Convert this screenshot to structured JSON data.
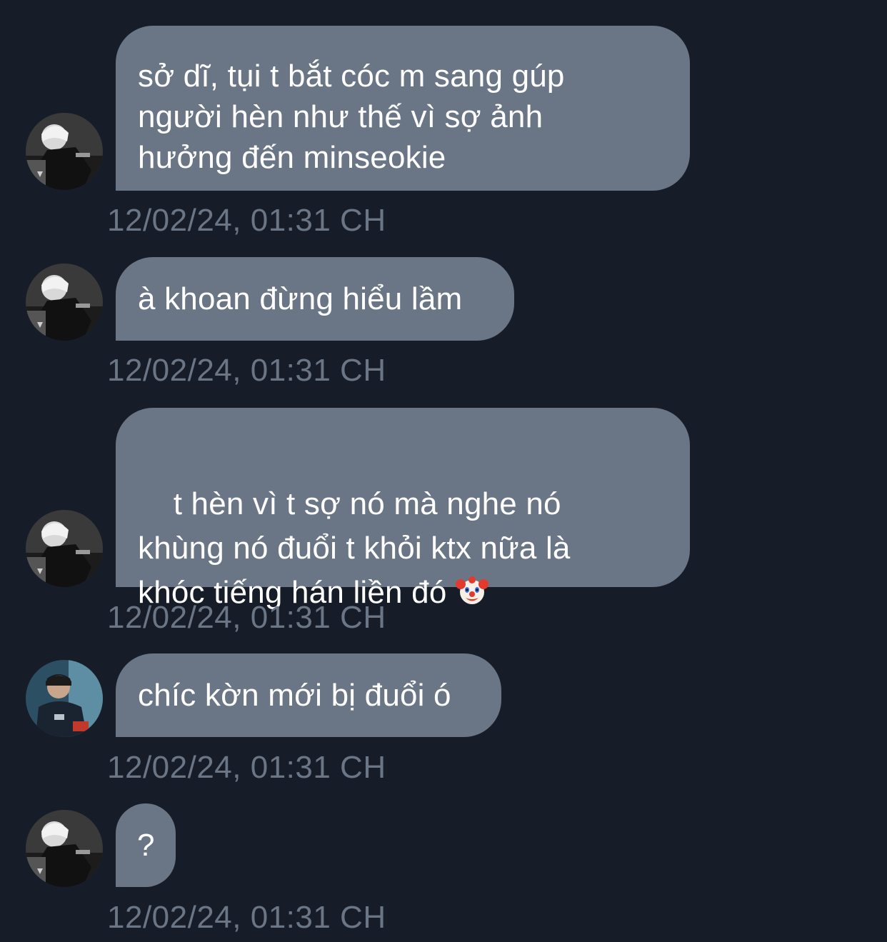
{
  "messages": [
    {
      "sender": "friend",
      "text": "sở dĩ, tụi t bắt cóc m sang gúp\nngười hèn như thế vì sợ ảnh\nhưởng đến minseokie",
      "time": "12/02/24, 01:31 CH"
    },
    {
      "sender": "friend",
      "text": "à khoan đừng hiểu lầm",
      "time": "12/02/24, 01:31 CH"
    },
    {
      "sender": "friend",
      "text": "t hèn vì t sợ nó mà nghe nó\nkhùng nó đuổi t khỏi ktx nữa là\nkhóc tiếng hán liền đó ",
      "emoji": "clown-face-emoji",
      "time": "12/02/24, 01:31 CH"
    },
    {
      "sender": "other",
      "text": "chíc kờn mới bị đuổi ó",
      "time": "12/02/24, 01:31 CH"
    },
    {
      "sender": "friend",
      "text": "?",
      "time": "12/02/24, 01:31 CH"
    }
  ],
  "colors": {
    "background": "#171d28",
    "bubble": "#6a7585",
    "timestamp": "#6a7585",
    "text": "#ffffff"
  }
}
